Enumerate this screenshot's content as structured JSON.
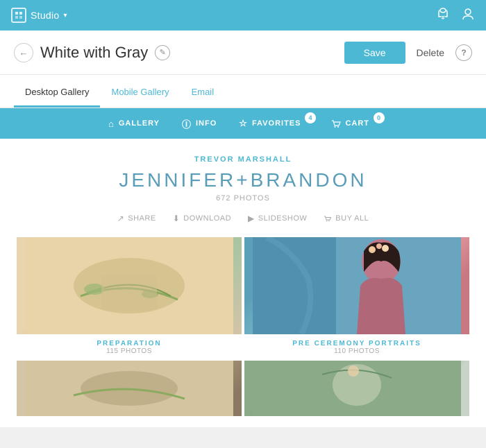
{
  "top_nav": {
    "logo_text": "Studio",
    "chevron": "▾",
    "bell_icon": "🔔",
    "user_icon": "👤"
  },
  "header": {
    "back_arrow": "←",
    "title": "White with Gray",
    "edit_icon": "✎",
    "save_label": "Save",
    "delete_label": "Delete",
    "help_label": "?"
  },
  "tabs": [
    {
      "label": "Desktop Gallery",
      "active": true
    },
    {
      "label": "Mobile Gallery",
      "active": false
    },
    {
      "label": "Email",
      "active": false
    }
  ],
  "gallery_nav": {
    "items": [
      {
        "label": "GALLERY",
        "icon": "⌂",
        "badge": null
      },
      {
        "label": "INFO",
        "icon": "ℹ",
        "badge": null
      },
      {
        "label": "FAVORITES",
        "icon": "☆",
        "badge": "4"
      },
      {
        "label": "CART",
        "icon": "⊠",
        "badge": "0"
      }
    ]
  },
  "gallery_content": {
    "photographer": "TREVOR MARSHALL",
    "title": "JENNIFER+BRANDON",
    "photo_count": "672 PHOTOS",
    "actions": [
      {
        "label": "SHARE",
        "icon": "↗"
      },
      {
        "label": "DOWNLOAD",
        "icon": "⬇"
      },
      {
        "label": "SLIDESHOW",
        "icon": "▶"
      },
      {
        "label": "BUY ALL",
        "icon": "🛒"
      }
    ]
  },
  "photo_albums": [
    {
      "title": "PREPARATION",
      "count": "115 PHOTOS",
      "type": "prep"
    },
    {
      "title": "PRE CEREMONY PORTRAITS",
      "count": "110 PHOTOS",
      "type": "portraits"
    },
    {
      "title": "",
      "count": "",
      "type": "bottom-left"
    },
    {
      "title": "",
      "count": "",
      "type": "bottom-right"
    }
  ]
}
